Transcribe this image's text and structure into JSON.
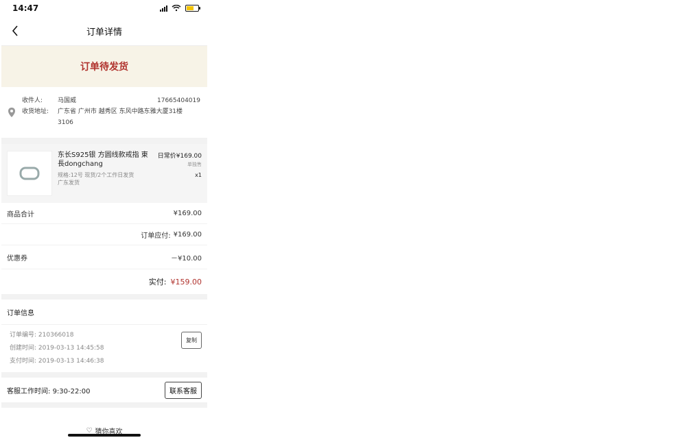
{
  "status": {
    "time": "14:47",
    "signal": "4 bars",
    "wifi": "wifi",
    "battery_level": "low"
  },
  "nav": {
    "title": "订单详情"
  },
  "banner": {
    "text": "订单待发货"
  },
  "address": {
    "recipient_label": "收件人:",
    "recipient_name": "马国威",
    "phone": "17665404019",
    "address_label": "收货地址:",
    "address_line1": "广东省 广州市 越秀区 东风中路东雅大厦31楼",
    "address_line2": "3106"
  },
  "product": {
    "name": "东长S925银 方圆线款戒指 東長dongchang",
    "price": "日常价¥169.00",
    "price_note": "单独售",
    "spec": "规格:12号 现货/2个工作日发货",
    "ship_from": "广东发货",
    "qty": "x1"
  },
  "summary": {
    "goods_total_label": "商品合计",
    "goods_total_value": "¥169.00",
    "order_due_label": "订单应付:",
    "order_due_value": "¥169.00",
    "coupon_label": "优惠券",
    "coupon_value": "－¥10.00",
    "paid_label": "实付:",
    "paid_value": "¥159.00"
  },
  "order_info": {
    "title": "订单信息",
    "order_no_label": "订单编号:",
    "order_no": "210366018",
    "created_label": "创建时间:",
    "created": "2019-03-13 14:45:58",
    "paid_label": "支付时间:",
    "paid": "2019-03-13 14:46:38",
    "copy_label": "复制"
  },
  "service": {
    "hours_label": "客服工作时间:",
    "hours": "9:30-22:00",
    "contact_label": "联系客服"
  },
  "footer": {
    "text": "猜你喜欢"
  },
  "colors": {
    "accent": "#b0322d",
    "banner_bg": "#f7f3e7"
  }
}
